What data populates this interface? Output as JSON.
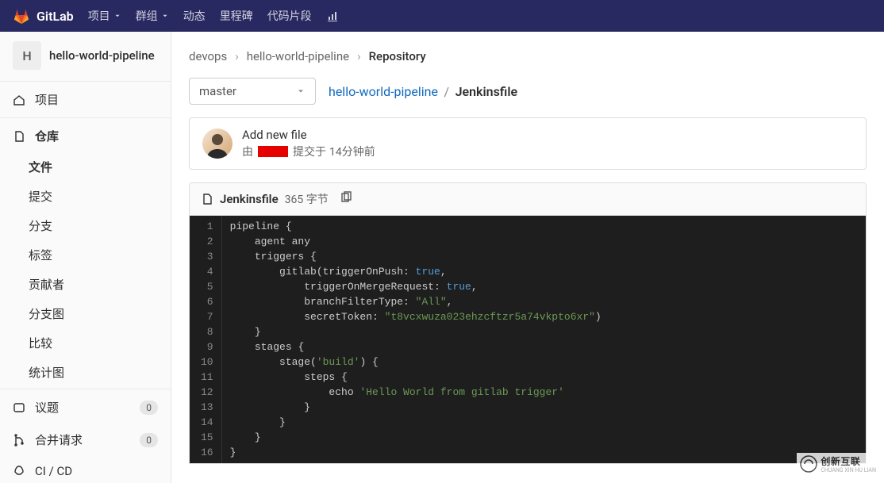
{
  "header": {
    "brand": "GitLab",
    "nav": {
      "projects": "项目",
      "groups": "群组",
      "activity": "动态",
      "milestones": "里程碑",
      "snippets": "代码片段"
    }
  },
  "sidebar": {
    "project_initial": "H",
    "project_name": "hello-world-pipeline",
    "items": {
      "project": "项目",
      "repository": "仓库",
      "issues": "议题",
      "merge_requests": "合并请求",
      "cicd": "CI / CD"
    },
    "repo_sub": {
      "files": "文件",
      "commits": "提交",
      "branches": "分支",
      "tags": "标签",
      "contributors": "贡献者",
      "graph": "分支图",
      "compare": "比较",
      "charts": "统计图"
    },
    "badges": {
      "issues": "0",
      "merge_requests": "0"
    }
  },
  "breadcrumb": {
    "group": "devops",
    "project": "hello-world-pipeline",
    "current": "Repository"
  },
  "branch": "master",
  "path": {
    "root": "hello-world-pipeline",
    "file": "Jenkinsfile"
  },
  "commit": {
    "title": "Add new file",
    "by_prefix": "由",
    "by_suffix": "提交于",
    "time": "14分钟前"
  },
  "file": {
    "name": "Jenkinsfile",
    "size": "365 字节"
  },
  "code": {
    "lines": [
      [
        [
          "kw",
          "pipeline "
        ],
        [
          "punc",
          "{"
        ]
      ],
      [
        [
          "kw",
          "    agent any"
        ]
      ],
      [
        [
          "kw",
          "    triggers "
        ],
        [
          "punc",
          "{"
        ]
      ],
      [
        [
          "kw",
          "        gitlab(triggerOnPush: "
        ],
        [
          "bool",
          "true"
        ],
        [
          "punc",
          ","
        ]
      ],
      [
        [
          "kw",
          "            triggerOnMergeRequest: "
        ],
        [
          "bool",
          "true"
        ],
        [
          "punc",
          ","
        ]
      ],
      [
        [
          "kw",
          "            branchFilterType: "
        ],
        [
          "str",
          "\"All\""
        ],
        [
          "punc",
          ","
        ]
      ],
      [
        [
          "kw",
          "            secretToken: "
        ],
        [
          "str",
          "\"t8vcxwuza023ehzcftzr5a74vkpto6xr\""
        ],
        [
          "punc",
          ")"
        ]
      ],
      [
        [
          "punc",
          "    }"
        ]
      ],
      [
        [
          "kw",
          "    stages "
        ],
        [
          "punc",
          "{"
        ]
      ],
      [
        [
          "kw",
          "        stage("
        ],
        [
          "str",
          "'build'"
        ],
        [
          "kw",
          ") "
        ],
        [
          "punc",
          "{"
        ]
      ],
      [
        [
          "kw",
          "            steps "
        ],
        [
          "punc",
          "{"
        ]
      ],
      [
        [
          "kw",
          "                echo "
        ],
        [
          "str",
          "'Hello World from gitlab trigger'"
        ]
      ],
      [
        [
          "punc",
          "            }"
        ]
      ],
      [
        [
          "punc",
          "        }"
        ]
      ],
      [
        [
          "punc",
          "    }"
        ]
      ],
      [
        [
          "punc",
          "}"
        ]
      ]
    ]
  },
  "watermark": {
    "main": "创新互联",
    "sub": "CHUANG XIN HU LIAN"
  }
}
